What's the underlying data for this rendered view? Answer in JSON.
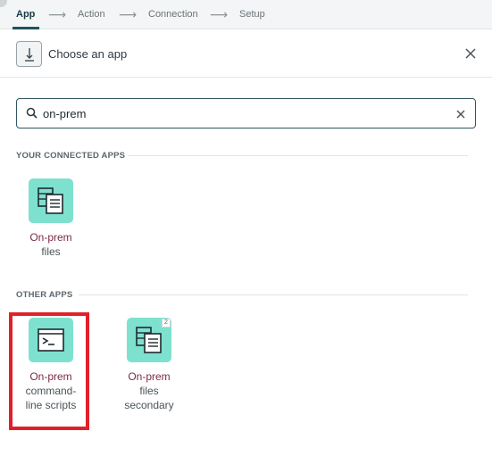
{
  "stepper": {
    "steps": [
      "App",
      "Action",
      "Connection",
      "Setup"
    ],
    "active": "App"
  },
  "header": {
    "title": "Choose an app"
  },
  "search": {
    "value": "on-prem"
  },
  "connected": {
    "heading": "YOUR CONNECTED APPS",
    "apps": [
      {
        "line1": "On-prem",
        "line2": "files",
        "icon": "file-server-icon"
      }
    ]
  },
  "other": {
    "heading": "OTHER APPS",
    "apps": [
      {
        "line1": "On-prem",
        "line2": "command-",
        "line3": "line scripts",
        "icon": "terminal-icon"
      },
      {
        "line1": "On-prem",
        "line2": "files",
        "line3": "secondary",
        "icon": "file-server-icon",
        "badge": "2"
      }
    ]
  },
  "colors": {
    "accent": "#1f5260",
    "app_tile_bg": "#7ee1cf",
    "app_name": "#7a2b4a",
    "highlight": "#e0202a"
  }
}
